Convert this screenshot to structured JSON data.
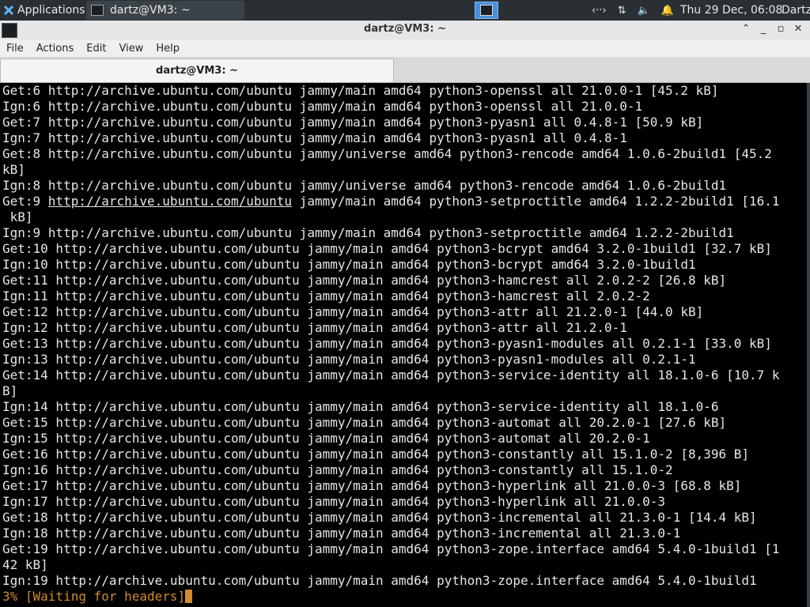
{
  "panel": {
    "apps_label": "Applications",
    "task_title": "dartz@VM3: ~",
    "clock": "Thu 29 Dec, 06:08",
    "user": "Dartz"
  },
  "window": {
    "title": "dartz@VM3: ~",
    "tab_title": "dartz@VM3: ~"
  },
  "menu": [
    "File",
    "Actions",
    "Edit",
    "View",
    "Help"
  ],
  "terminal": {
    "lines": [
      "Get:6 http://archive.ubuntu.com/ubuntu jammy/main amd64 python3-openssl all 21.0.0-1 [45.2 kB]",
      "Ign:6 http://archive.ubuntu.com/ubuntu jammy/main amd64 python3-openssl all 21.0.0-1",
      "Get:7 http://archive.ubuntu.com/ubuntu jammy/main amd64 python3-pyasn1 all 0.4.8-1 [50.9 kB]",
      "Ign:7 http://archive.ubuntu.com/ubuntu jammy/main amd64 python3-pyasn1 all 0.4.8-1",
      "Get:8 http://archive.ubuntu.com/ubuntu jammy/universe amd64 python3-rencode amd64 1.0.6-2build1 [45.2",
      "kB]",
      "Ign:8 http://archive.ubuntu.com/ubuntu jammy/universe amd64 python3-rencode amd64 1.0.6-2build1",
      "Get:9 http://archive.ubuntu.com/ubuntu jammy/main amd64 python3-setproctitle amd64 1.2.2-2build1 [16.1",
      " kB]",
      "Ign:9 http://archive.ubuntu.com/ubuntu jammy/main amd64 python3-setproctitle amd64 1.2.2-2build1",
      "Get:10 http://archive.ubuntu.com/ubuntu jammy/main amd64 python3-bcrypt amd64 3.2.0-1build1 [32.7 kB]",
      "Ign:10 http://archive.ubuntu.com/ubuntu jammy/main amd64 python3-bcrypt amd64 3.2.0-1build1",
      "Get:11 http://archive.ubuntu.com/ubuntu jammy/main amd64 python3-hamcrest all 2.0.2-2 [26.8 kB]",
      "Ign:11 http://archive.ubuntu.com/ubuntu jammy/main amd64 python3-hamcrest all 2.0.2-2",
      "Get:12 http://archive.ubuntu.com/ubuntu jammy/main amd64 python3-attr all 21.2.0-1 [44.0 kB]",
      "Ign:12 http://archive.ubuntu.com/ubuntu jammy/main amd64 python3-attr all 21.2.0-1",
      "Get:13 http://archive.ubuntu.com/ubuntu jammy/main amd64 python3-pyasn1-modules all 0.2.1-1 [33.0 kB]",
      "Ign:13 http://archive.ubuntu.com/ubuntu jammy/main amd64 python3-pyasn1-modules all 0.2.1-1",
      "Get:14 http://archive.ubuntu.com/ubuntu jammy/main amd64 python3-service-identity all 18.1.0-6 [10.7 k",
      "B]",
      "Ign:14 http://archive.ubuntu.com/ubuntu jammy/main amd64 python3-service-identity all 18.1.0-6",
      "Get:15 http://archive.ubuntu.com/ubuntu jammy/main amd64 python3-automat all 20.2.0-1 [27.6 kB]",
      "Ign:15 http://archive.ubuntu.com/ubuntu jammy/main amd64 python3-automat all 20.2.0-1",
      "Get:16 http://archive.ubuntu.com/ubuntu jammy/main amd64 python3-constantly all 15.1.0-2 [8,396 B]",
      "Ign:16 http://archive.ubuntu.com/ubuntu jammy/main amd64 python3-constantly all 15.1.0-2",
      "Get:17 http://archive.ubuntu.com/ubuntu jammy/main amd64 python3-hyperlink all 21.0.0-3 [68.8 kB]",
      "Ign:17 http://archive.ubuntu.com/ubuntu jammy/main amd64 python3-hyperlink all 21.0.0-3",
      "Get:18 http://archive.ubuntu.com/ubuntu jammy/main amd64 python3-incremental all 21.3.0-1 [14.4 kB]",
      "Ign:18 http://archive.ubuntu.com/ubuntu jammy/main amd64 python3-incremental all 21.3.0-1",
      "Get:19 http://archive.ubuntu.com/ubuntu jammy/main amd64 python3-zope.interface amd64 5.4.0-1build1 [1",
      "42 kB]",
      "Ign:19 http://archive.ubuntu.com/ubuntu jammy/main amd64 python3-zope.interface amd64 5.4.0-1build1"
    ],
    "status": "3% [Waiting for headers]",
    "status_color": "#d08a2c",
    "underlined_line_index": 7,
    "underlined_text": "http://archive.ubuntu.com/ubuntu"
  }
}
